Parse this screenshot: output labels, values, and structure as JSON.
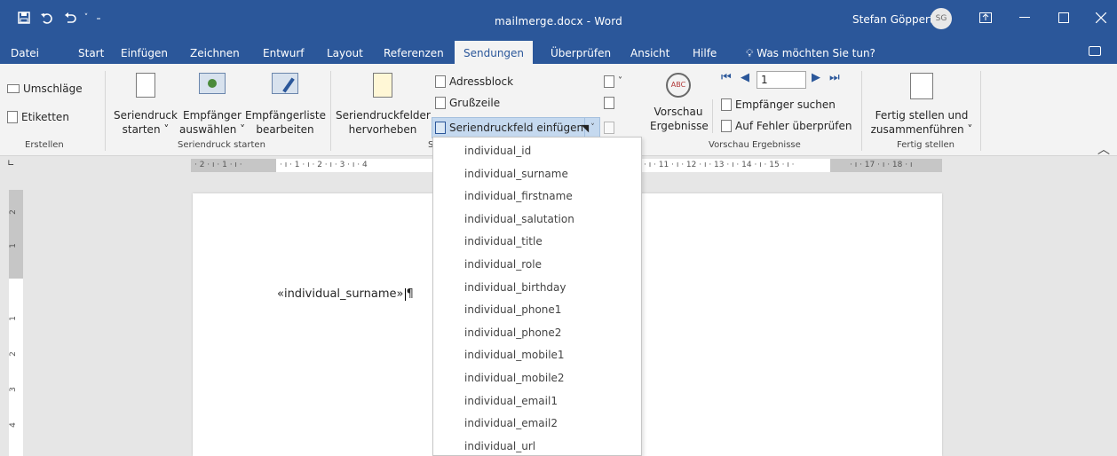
{
  "titlebar": {
    "title": "mailmerge.docx - Word",
    "user_name": "Stefan Göppert",
    "user_initials": "SG",
    "icons": [
      "save-icon",
      "undo-icon",
      "redo-icon",
      "customize-qat-icon",
      "ribbon-display-icon",
      "minimize-icon",
      "maximize-icon",
      "close-icon"
    ]
  },
  "tabs": {
    "items": [
      "Datei",
      "Start",
      "Einfügen",
      "Zeichnen",
      "Entwurf",
      "Layout",
      "Referenzen",
      "Sendungen",
      "Überprüfen",
      "Ansicht",
      "Hilfe"
    ],
    "active": "Sendungen",
    "tell_me": "Was möchten Sie tun?"
  },
  "ribbon": {
    "erstellen": {
      "umschlaege": "Umschläge",
      "etiketten": "Etiketten",
      "label": "Erstellen"
    },
    "seriendruck_starten": {
      "seriendruck_line1": "Seriendruck",
      "seriendruck_line2": "starten ˅",
      "empfaenger_line1": "Empfänger",
      "empfaenger_line2": "auswählen ˅",
      "liste_line1": "Empfängerliste",
      "liste_line2": "bearbeiten",
      "label": "Seriendruck starten"
    },
    "felder": {
      "hervorheben_line1": "Seriendruckfelder",
      "hervorheben_line2": "hervorheben",
      "adressblock": "Adressblock",
      "grusszeile": "Grußzeile",
      "feld_einfuegen": "Seriendruckfeld einfügen",
      "label": "S"
    },
    "vorschau": {
      "vorschau_line1": "Vorschau",
      "vorschau_line2": "Ergebnisse",
      "record": "1",
      "empfaenger_suchen": "Empfänger suchen",
      "fehler": "Auf Fehler überprüfen",
      "label": "Vorschau Ergebnisse"
    },
    "fertig": {
      "line1": "Fertig stellen und",
      "line2": "zusammenführen ˅",
      "label": "Fertig stellen"
    }
  },
  "ruler": {
    "left_ticks": "· 2 · ı · 1 · ı ·",
    "mid_ticks": "· ı · 1 · ı · 2 · ı · 3 · ı · 4",
    "right_ticks": "· ı · 11 · ı · 12 · ı · 13 · ı · 14 · ı · 15 · ı ·",
    "far_ticks": "· ı · 17 · ı · 18 · ı",
    "vertical": [
      "2",
      "1",
      "1",
      "2",
      "3",
      "4"
    ]
  },
  "document": {
    "merge_field": "«individual_surname»",
    "pilcrow": "¶"
  },
  "dropdown": {
    "items": [
      "individual_id",
      "individual_surname",
      "individual_firstname",
      "individual_salutation",
      "individual_title",
      "individual_role",
      "individual_birthday",
      "individual_phone1",
      "individual_phone2",
      "individual_mobile1",
      "individual_mobile2",
      "individual_email1",
      "individual_email2",
      "individual_url"
    ]
  },
  "colors": {
    "accent": "#2b579a",
    "ribbon": "#f3f3f3",
    "highlight": "#c5d9ef"
  }
}
